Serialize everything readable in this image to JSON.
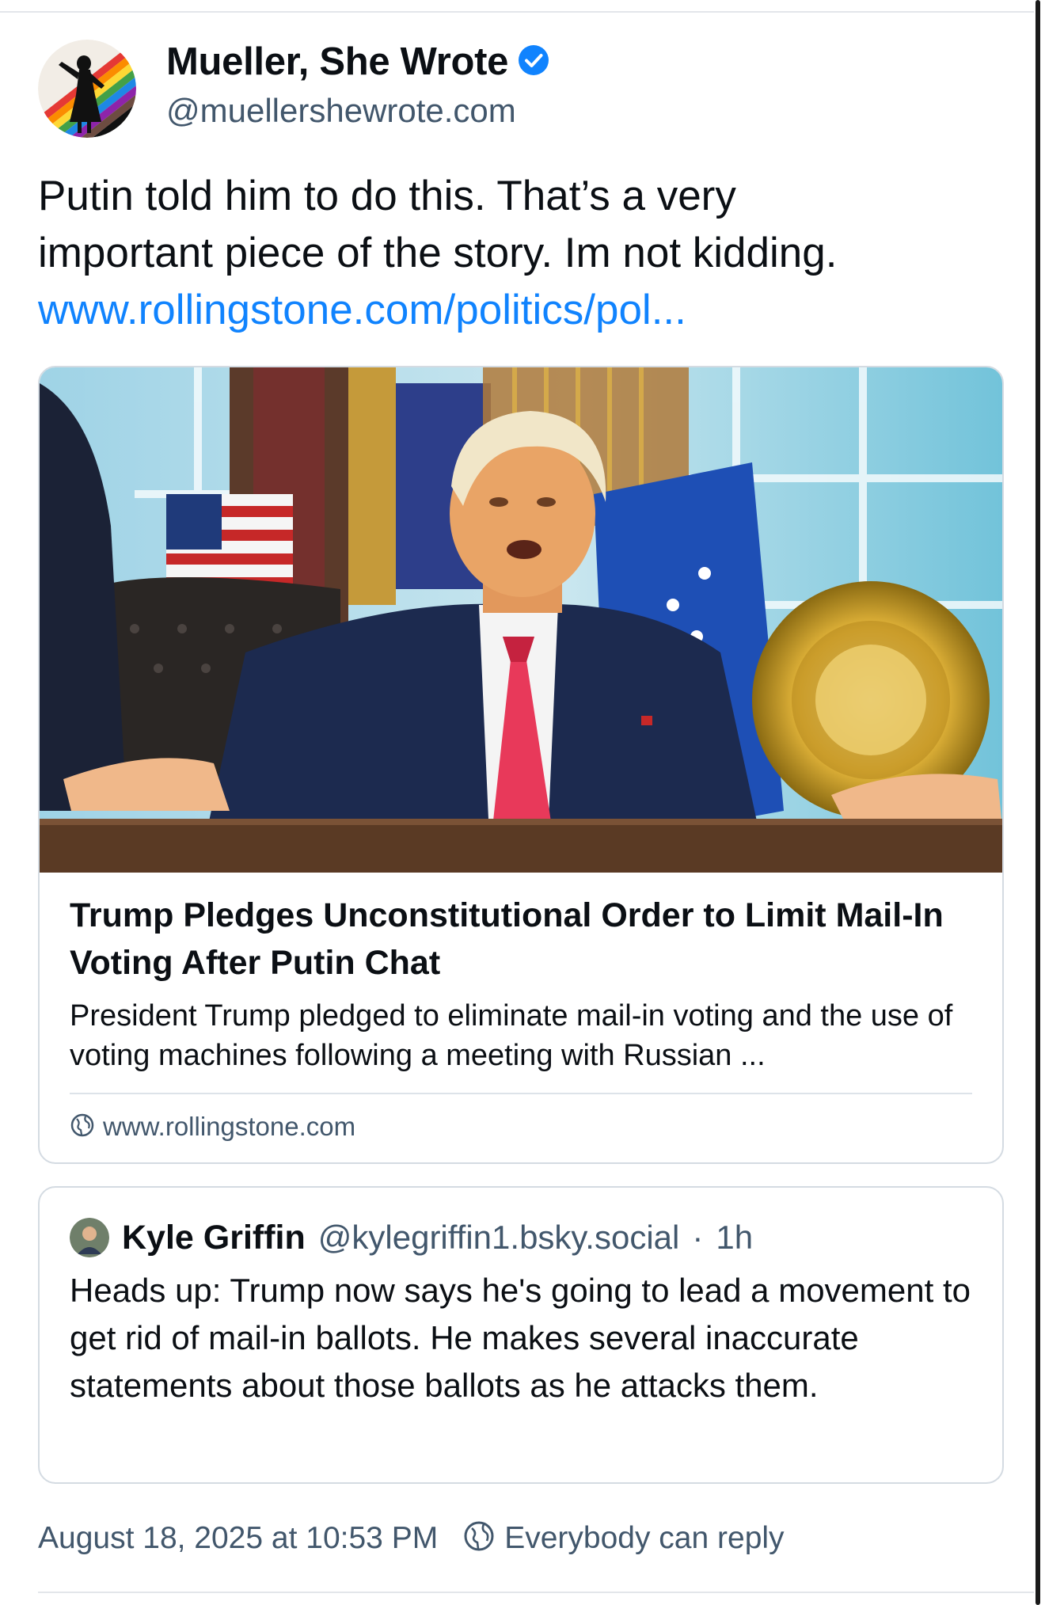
{
  "author": {
    "display_name": "Mueller, She Wrote",
    "handle": "@muellershewrote.com",
    "verified": true
  },
  "post": {
    "text_line1": "Putin told him to do this. That’s a very",
    "text_line2": "important piece of the story. Im not kidding.",
    "link_text": "www.rollingstone.com/politics/pol..."
  },
  "link_card": {
    "title": "Trump Pledges Unconstitutional Order to Limit Mail-In Voting After Putin Chat",
    "description": "President Trump pledged to eliminate mail-in voting and the use of voting machines following a meeting with Russian ...",
    "domain": "www.rollingstone.com",
    "icon": "globe-icon"
  },
  "quote": {
    "display_name": "Kyle Griffin",
    "handle": "@kylegriffin1.bsky.social",
    "separator": "·",
    "time": "1h",
    "text": "Heads up: Trump now says he's going to lead a movement to get rid of mail-in ballots. He makes several inaccurate statements about those ballots as he attacks them."
  },
  "footer": {
    "timestamp": "August 18, 2025 at 10:53 PM",
    "reply_setting": "Everybody can reply",
    "icon": "reply-globe-icon"
  },
  "colors": {
    "link": "#1083fe",
    "muted": "#42576c",
    "verified": "#1083fe",
    "border": "#d4dbe2"
  }
}
